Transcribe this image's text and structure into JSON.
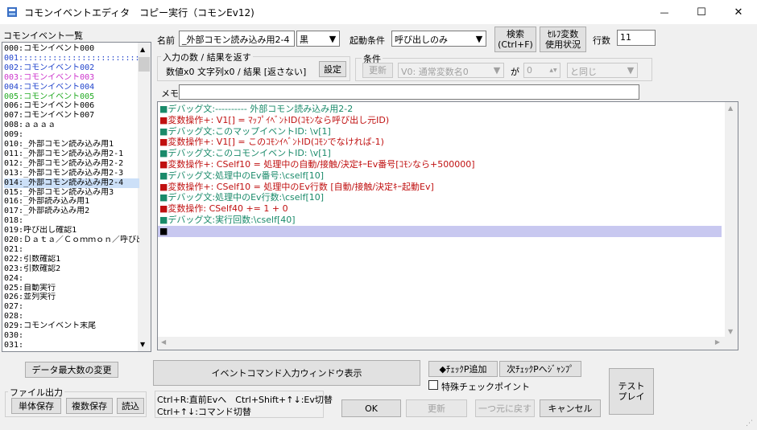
{
  "window": {
    "title": "コモンイベントエディタ　コピー実行（コモンEv12)",
    "minimize_glyph": "—",
    "maximize_glyph": "☐",
    "close_glyph": "✕"
  },
  "list_header": "コモンイベント一覧",
  "list_items": [
    {
      "text": "000:コモンイベント000",
      "color": "#000000"
    },
    {
      "text": "001::::::::::::::::::::::::::::",
      "color": "#2244cc"
    },
    {
      "text": "002:コモンイベント002",
      "color": "#2244cc"
    },
    {
      "text": "003:コモンイベント003",
      "color": "#cc33cc"
    },
    {
      "text": "004:コモンイベント004",
      "color": "#2244cc"
    },
    {
      "text": "005:コモンイベント005",
      "color": "#22aa22"
    },
    {
      "text": "006:コモンイベント006",
      "color": "#000000"
    },
    {
      "text": "007:コモンイベント007",
      "color": "#000000"
    },
    {
      "text": "008:ａａａａ",
      "color": "#000000"
    },
    {
      "text": "009:",
      "color": "#000000"
    },
    {
      "text": "010:_外部コモン読み込み用1",
      "color": "#000000"
    },
    {
      "text": "011:_外部コモン読み込み用2-1",
      "color": "#000000"
    },
    {
      "text": "012:_外部コモン読み込み用2-2",
      "color": "#000000"
    },
    {
      "text": "013:_外部コモン読み込み用2-3",
      "color": "#000000"
    },
    {
      "text": "014:_外部コモン読み込み用2-4",
      "color": "#000000",
      "selected": true
    },
    {
      "text": "015:_外部コモン読み込み用3",
      "color": "#000000"
    },
    {
      "text": "016:_外部読み込み用1",
      "color": "#000000"
    },
    {
      "text": "017:_外部読み込み用2",
      "color": "#000000"
    },
    {
      "text": "018:",
      "color": "#000000"
    },
    {
      "text": "019:呼び出し確認1",
      "color": "#000000"
    },
    {
      "text": "020:Ｄａｔａ／Ｃｏｍｍｏｎ／呼び出し",
      "color": "#000000"
    },
    {
      "text": "021:",
      "color": "#000000"
    },
    {
      "text": "022:引数確認1",
      "color": "#000000"
    },
    {
      "text": "023:引数確認2",
      "color": "#000000"
    },
    {
      "text": "024:",
      "color": "#000000"
    },
    {
      "text": "025:自動実行",
      "color": "#000000"
    },
    {
      "text": "026:並列実行",
      "color": "#000000"
    },
    {
      "text": "027:",
      "color": "#000000"
    },
    {
      "text": "028:",
      "color": "#000000"
    },
    {
      "text": "029:コモンイベント末尾",
      "color": "#000000"
    },
    {
      "text": "030:",
      "color": "#000000"
    },
    {
      "text": "031:",
      "color": "#000000"
    }
  ],
  "name_label": "名前",
  "name_value": "_外部コモン読み込み用2-4",
  "color_value": "黒",
  "trigger_label": "起動条件",
  "trigger_value": "呼び出しのみ",
  "search_btn": "検索\n(Ctrl+F)",
  "self_var_btn": "ｾﾙﾌ変数\n使用状況",
  "row_count_label": "行数",
  "row_count_value": "11",
  "io_group_title": "入力の数 / 結果を返す",
  "io_summary": "数値x0 文字列x0 / 結果 [返さない]",
  "io_settings_btn": "設定",
  "cond_group_title": "条件",
  "cond_update_btn": "更新",
  "cond_var_value": "V0: 通常変数名0",
  "cond_ga": "が",
  "cond_num_value": "0",
  "cond_op_value": "と同じ",
  "memo_label": "メモ",
  "memo_value": "",
  "commands": [
    {
      "text": "■デバッグ文:---------- 外部コモン読み込み用2-2",
      "color": "#1a8a6a"
    },
    {
      "text": "■変数操作+: V1[] = ﾏｯﾌﾟｲﾍﾞﾝﾄID(ｺﾓﾝなら呼び出し元ID)",
      "color": "#c01010"
    },
    {
      "text": "■デバッグ文:このマップイベントID: \\v[1]",
      "color": "#1a8a6a"
    },
    {
      "text": "■変数操作+: V1[] = このｺﾓﾝｲﾍﾞﾝﾄID(ｺﾓﾝでなければ-1)",
      "color": "#c01010"
    },
    {
      "text": "■デバッグ文:このコモンイベントID: \\v[1]",
      "color": "#1a8a6a"
    },
    {
      "text": "■変数操作+: CSelf10 = 処理中の自動/接触/決定ｷｰEv番号[ｺﾓﾝなら+500000]",
      "color": "#c01010"
    },
    {
      "text": "■デバッグ文:処理中のEv番号:\\cself[10]",
      "color": "#1a8a6a"
    },
    {
      "text": "■変数操作+: CSelf10 = 処理中のEv行数 [自動/接触/決定ｷｰ起動Ev]",
      "color": "#c01010"
    },
    {
      "text": "■デバッグ文:処理中のEv行数:\\cself[10]",
      "color": "#1a8a6a"
    },
    {
      "text": "■変数操作: CSelf40 += 1 + 0",
      "color": "#c01010"
    },
    {
      "text": "■デバッグ文:実行回数:\\cself[40]",
      "color": "#1a8a6a"
    },
    {
      "text": "■",
      "color": "#000000",
      "highlight": true
    }
  ],
  "change_max_btn": "データ最大数の変更",
  "insert_window_btn": "イベントコマンド入力ウィンドウ表示",
  "add_checkpoint_btn": "◆ﾁｪｯｸP追加",
  "next_checkpoint_btn": "次ﾁｪｯｸPへｼﾞｬﾝﾌﾟ",
  "special_checkpoint_label": "特殊チェックポイント",
  "test_play_btn": "テスト\nプレイ",
  "file_group_title": "ファイル出力",
  "single_save_btn": "単体保存",
  "multi_save_btn": "複数保存",
  "load_btn": "読込",
  "hint_line1": "Ctrl+R:直前Evへ　Ctrl+Shift+↑↓:Ev切替",
  "hint_line2": "Ctrl+↑↓:コマンド切替",
  "ok_btn": "OK",
  "update_btn": "更新",
  "undo_btn": "一つ元に戻す",
  "cancel_btn": "キャンセル"
}
